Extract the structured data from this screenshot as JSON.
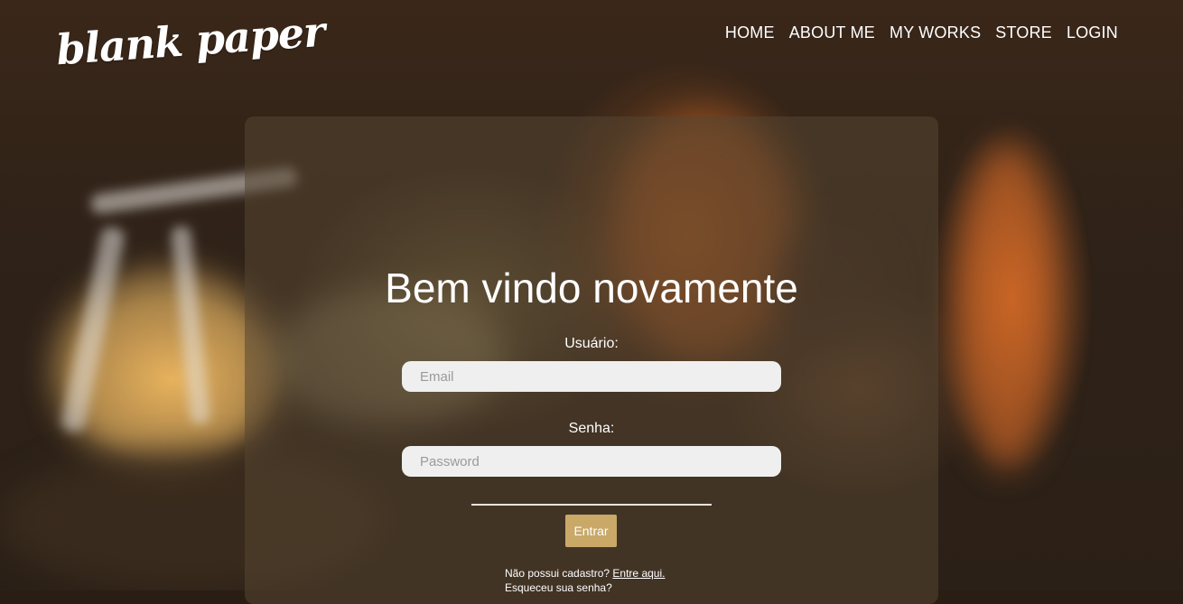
{
  "brand": {
    "logo_text": "blank paper"
  },
  "nav": {
    "items": [
      {
        "label": "HOME"
      },
      {
        "label": "ABOUT ME"
      },
      {
        "label": "MY WORKS"
      },
      {
        "label": "STORE"
      },
      {
        "label": "LOGIN"
      }
    ]
  },
  "login": {
    "title": "Bem vindo novamente",
    "username_label": "Usuário:",
    "username_placeholder": "Email",
    "password_label": "Senha:",
    "password_placeholder": "Password",
    "submit_label": "Entrar",
    "no_account_text": "Não possui cadastro?",
    "signup_link": "Entre aqui.",
    "forgot_password_text": "Esqueceu sua senha?"
  },
  "colors": {
    "accent_button": "#c9a868",
    "panel": "rgba(85,70,50,0.55)",
    "input_bg": "#efefef"
  }
}
